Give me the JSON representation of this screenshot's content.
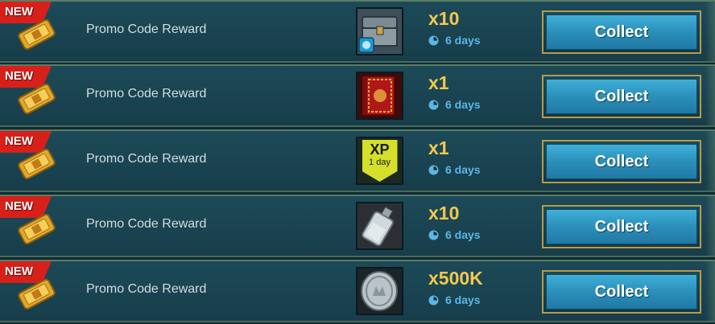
{
  "rewards": [
    {
      "badge": "NEW",
      "title": "Promo Code Reward",
      "item_icon": "treasure-chest-icon",
      "quantity": "x10",
      "timer": "6 days",
      "button": "Collect"
    },
    {
      "badge": "NEW",
      "title": "Promo Code Reward",
      "item_icon": "red-book-icon",
      "quantity": "x1",
      "timer": "6 days",
      "button": "Collect",
      "thumb_bg": "#3a0c0c"
    },
    {
      "badge": "NEW",
      "title": "Promo Code Reward",
      "item_icon": "xp-boost-icon",
      "quantity": "x1",
      "timer": "6 days",
      "button": "Collect",
      "xp_label": "XP",
      "xp_duration": "1 day"
    },
    {
      "badge": "NEW",
      "title": "Promo Code Reward",
      "item_icon": "potion-flask-icon",
      "quantity": "x10",
      "timer": "6 days",
      "button": "Collect"
    },
    {
      "badge": "NEW",
      "title": "Promo Code Reward",
      "item_icon": "silver-coin-icon",
      "quantity": "x500K",
      "timer": "6 days",
      "button": "Collect"
    }
  ],
  "colors": {
    "badge_red": "#d8201a",
    "quantity_gold": "#f2c84c",
    "timer_blue": "#5bb6e6",
    "button_blue": "#2b8fba",
    "button_border_gold": "#b89a4a"
  }
}
